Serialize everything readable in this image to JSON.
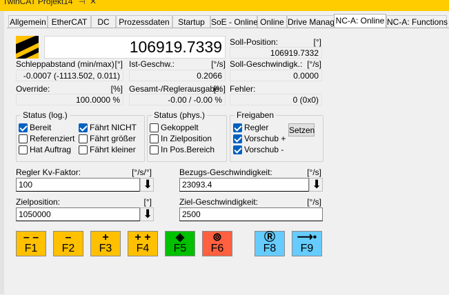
{
  "window": {
    "title": "TwinCAT Projekt14",
    "pin_glyph": "⊣",
    "close_glyph": "✕"
  },
  "tabs": [
    {
      "label": "Allgemein"
    },
    {
      "label": "EtherCAT"
    },
    {
      "label": "DC"
    },
    {
      "label": "Prozessdaten"
    },
    {
      "label": "Startup"
    },
    {
      "label": "SoE - Online"
    },
    {
      "label": "Online"
    },
    {
      "label": "Drive Manager"
    },
    {
      "label": "NC-A: Online",
      "active": true
    },
    {
      "label": "NC-A: Functions"
    }
  ],
  "position": {
    "value": "106919.7339"
  },
  "soll_position": {
    "label": "Soll-Position:",
    "unit": "[°]",
    "value": "106919.7332"
  },
  "schleppabstand": {
    "label": "Schleppabstand (min/max)",
    "unit": "[°]",
    "value": "-0.0007  (-1113.502, 0.011)"
  },
  "ist_geschw": {
    "label": "Ist-Geschw.:",
    "unit": "[°/s]",
    "value": "0.2066"
  },
  "soll_geschw": {
    "label": "Soll-Geschwindigk.:",
    "unit": "[°/s]",
    "value": "0.0000"
  },
  "override": {
    "label": "Override:",
    "unit": "[%]",
    "value": "100.0000 %"
  },
  "gesamt": {
    "label": "Gesamt-/Reglerausgabe:",
    "unit": "[%]",
    "value": "-0.00 / -0.00 %"
  },
  "fehler": {
    "label": "Fehler:",
    "value": "0 (0x0)"
  },
  "status_log": {
    "title": "Status (log.)",
    "items": [
      {
        "label": "Bereit",
        "checked": true
      },
      {
        "label": "Referenziert",
        "checked": false
      },
      {
        "label": "Hat Auftrag",
        "checked": false
      },
      {
        "label": "Fährt NICHT",
        "checked": true
      },
      {
        "label": "Fährt größer",
        "checked": false
      },
      {
        "label": "Fährt kleiner",
        "checked": false
      }
    ]
  },
  "status_phys": {
    "title": "Status (phys.)",
    "items": [
      {
        "label": "Gekoppelt",
        "checked": false
      },
      {
        "label": "In Zielposition",
        "checked": false
      },
      {
        "label": "In Pos.Bereich",
        "checked": false
      }
    ]
  },
  "freigaben": {
    "title": "Freigaben",
    "items": [
      {
        "label": "Regler",
        "checked": true
      },
      {
        "label": "Vorschub +",
        "checked": true
      },
      {
        "label": "Vorschub -",
        "checked": true
      }
    ],
    "set_button": "Setzen"
  },
  "kv": {
    "label": "Regler Kv-Faktor:",
    "unit": "[°/s/°]",
    "value": "100"
  },
  "bezugs": {
    "label": "Bezugs-Geschwindigkeit:",
    "unit": "[°/s]",
    "value": "23093.4"
  },
  "zielpos": {
    "label": "Zielposition:",
    "unit": "[°]",
    "value": "1050000"
  },
  "zielgeschw": {
    "label": "Ziel-Geschwindigkeit:",
    "unit": "[°/s]",
    "value": "2500"
  },
  "fkeys": [
    {
      "label": "F1",
      "symbol": "– –",
      "color": "#ffc000"
    },
    {
      "label": "F2",
      "symbol": "–",
      "color": "#ffc000"
    },
    {
      "label": "F3",
      "symbol": "+",
      "color": "#ffc000"
    },
    {
      "label": "F4",
      "symbol": "+ +",
      "color": "#ffc000"
    },
    {
      "label": "F5",
      "symbol": "◈",
      "color": "#00c000"
    },
    {
      "label": "F6",
      "symbol": "⊚",
      "color": "#ff6040"
    },
    {
      "label": "F8",
      "symbol": "Ⓡ",
      "color": "#66ccff"
    },
    {
      "label": "F9",
      "symbol": "⟶•",
      "color": "#66ccff"
    }
  ],
  "icons": {
    "arrow_down": "⬇"
  },
  "colors": {
    "title_bar": "#ffcc00",
    "check_on": "#0060c0"
  }
}
